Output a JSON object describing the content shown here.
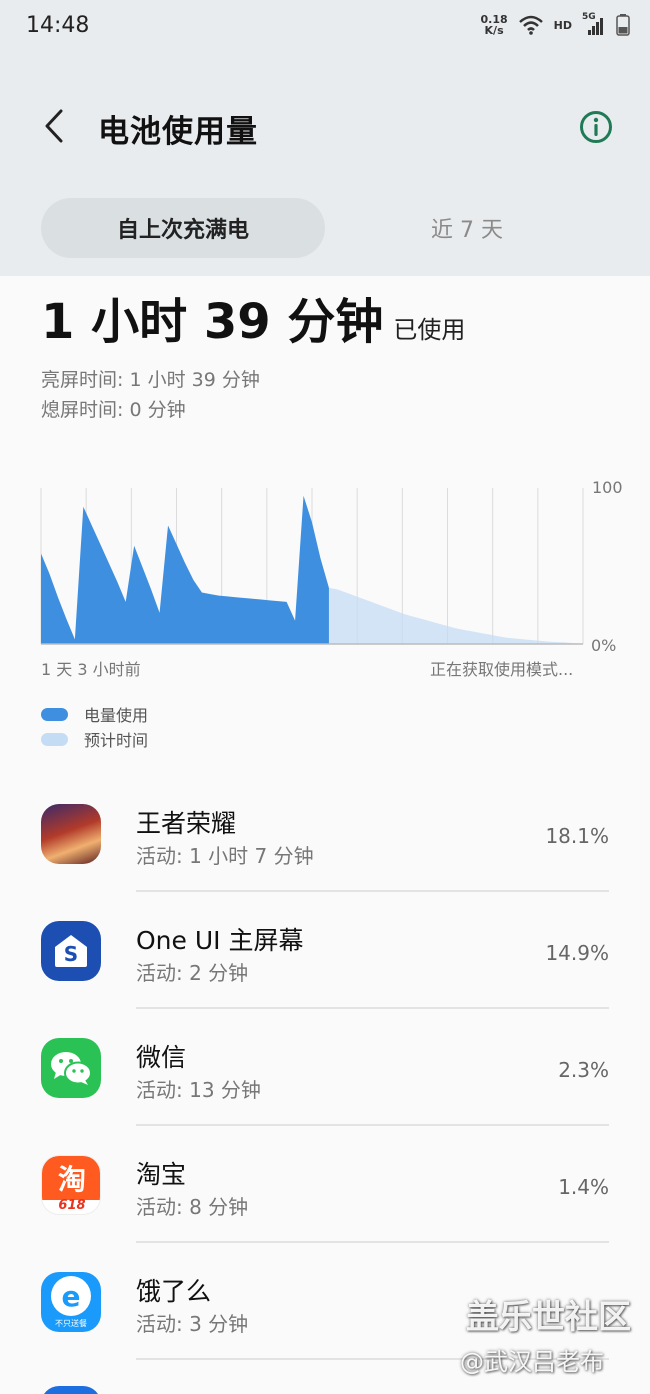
{
  "status_bar": {
    "time": "14:48",
    "net_speed_value": "0.18",
    "net_speed_unit": "K/s",
    "hd": "HD",
    "signal": "5G"
  },
  "header": {
    "title": "电池使用量",
    "back_icon": "chevron-left-icon",
    "info_icon": "info-icon"
  },
  "tabs": [
    {
      "label": "自上次充满电",
      "selected": true
    },
    {
      "label": "近 7 天",
      "selected": false
    }
  ],
  "summary": {
    "used_time": "1 小时 39 分钟",
    "used_suffix": "已使用",
    "screen_on": "亮屏时间:  1 小时 39 分钟",
    "screen_off": "熄屏时间:   0 分钟"
  },
  "chart": {
    "y_top_label": "100",
    "y_bottom_label": "0%",
    "x_start_label": "1 天 3 小时前",
    "x_end_label": "正在获取使用模式...",
    "colors": {
      "usage": "#3f8fe0",
      "predicted": "#c5dcf5",
      "highlight": "#8fbdef"
    }
  },
  "chart_data": {
    "type": "area",
    "ylim": [
      0,
      100
    ],
    "series": [
      {
        "name": "电量使用",
        "x": [
          0,
          1,
          2,
          3,
          4,
          5,
          6,
          7,
          8,
          9,
          10,
          11,
          12,
          13,
          14,
          15,
          16,
          17,
          18,
          19,
          20,
          21,
          22,
          23,
          24,
          25,
          26,
          27,
          28,
          29,
          30,
          31,
          32,
          33,
          34,
          35,
          36,
          37,
          38,
          39,
          40,
          41,
          42,
          43,
          44,
          45,
          46,
          47,
          48,
          49,
          50,
          51,
          52,
          53,
          54,
          55,
          56,
          57,
          58,
          59,
          60,
          61,
          62,
          63,
          64
        ],
        "y": [
          58,
          45,
          30,
          16,
          3,
          88,
          76,
          64,
          52,
          40,
          27,
          63,
          49,
          35,
          20,
          76,
          64,
          52,
          41,
          33,
          32,
          31,
          30.5,
          30,
          29.5,
          29,
          28.5,
          28,
          27.5,
          27,
          15,
          95,
          78,
          55,
          36,
          35,
          33,
          31,
          29,
          27,
          25,
          23,
          21,
          19,
          17.5,
          16,
          14.5,
          13,
          11.5,
          10,
          9,
          8,
          7,
          6,
          5,
          4,
          3.5,
          3,
          2.5,
          2,
          1.5,
          1.2,
          1,
          0.5,
          0
        ]
      },
      {
        "name": "预计时间"
      }
    ]
  },
  "legend": [
    {
      "label": "电量使用"
    },
    {
      "label": "预计时间"
    }
  ],
  "apps": [
    {
      "name": "王者荣耀",
      "activity": "活动: 1 小时 7 分钟",
      "percent": "18.1%",
      "icon": "honor-of-kings-icon"
    },
    {
      "name": "One UI 主屏幕",
      "activity": "活动: 2 分钟",
      "percent": "14.9%",
      "icon": "one-ui-home-icon",
      "icon_glyph": "S"
    },
    {
      "name": "微信",
      "activity": "活动: 13 分钟",
      "percent": "2.3%",
      "icon": "wechat-icon"
    },
    {
      "name": "淘宝",
      "activity": "活动: 8 分钟",
      "percent": "1.4%",
      "icon": "taobao-icon",
      "icon_glyph": "淘",
      "icon_sub": "618"
    },
    {
      "name": "饿了么",
      "activity": "活动: 3 分钟",
      "percent": "",
      "icon": "eleme-icon",
      "icon_glyph": "e",
      "icon_sub": "不只送餐"
    }
  ],
  "watermark": {
    "line1": "盖乐世社区",
    "line2": "@武汉吕老布"
  }
}
